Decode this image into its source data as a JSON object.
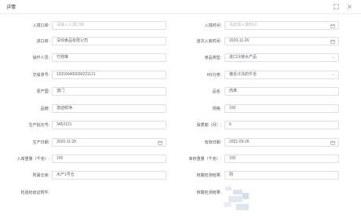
{
  "dialog": {
    "title": "详情",
    "fullscreen_icon": "fullscreen-icon",
    "close_icon": "close-icon"
  },
  "form": {
    "row1": {
      "left_label": "入境口岸:",
      "left_placeholder": "请输入入境口岸",
      "right_label": "入境时间:",
      "right_placeholder": "请选择入境时间"
    },
    "row2": {
      "left_label": "进口商:",
      "left_value": "深圳食品有限公司",
      "right_label": "首次入库时间:",
      "right_value": "2020-11-26"
    },
    "row3": {
      "left_label": "操作人员:",
      "left_value": "付桂琳",
      "right_label": "食品类型:",
      "right_value": "进口冷链水产品"
    },
    "row4": {
      "left_label": "交易单号:",
      "left_value": "133169400000221121",
      "right_label": "HS分类:",
      "right_value": "猪舌冷冻的牛舌"
    },
    "row5": {
      "left_label": "原产国:",
      "left_value": "澳门",
      "right_label": "品名:",
      "right_value": "肉禽"
    },
    "row6": {
      "left_label": "品牌:",
      "left_value": "澳迪鲜净",
      "right_label": "规格:",
      "right_value": "100"
    },
    "row7": {
      "left_label": "生产批次号:",
      "left_value": "3452121",
      "right_label": "保质期（月）:",
      "right_value": "6"
    },
    "row8": {
      "left_label": "生产日期:",
      "left_value": "2020-11-26",
      "right_label": "有效日期:",
      "right_value": "2021-05-26"
    },
    "row9": {
      "left_label": "入库重量（千克）:",
      "left_value": "100",
      "right_label": "库存重量（千克）:",
      "right_value": "100"
    },
    "row10": {
      "left_label": "所属仓库:",
      "left_value": "水产1号仓",
      "right_label": "核酸检测结果:",
      "right_value": "阴"
    },
    "row11": {
      "left_label": "检验检疫证附件:",
      "right_label": "核酸检测结果:"
    }
  },
  "icons": {
    "calendar": "calendar-icon",
    "chevron": "chevron-down-icon"
  }
}
